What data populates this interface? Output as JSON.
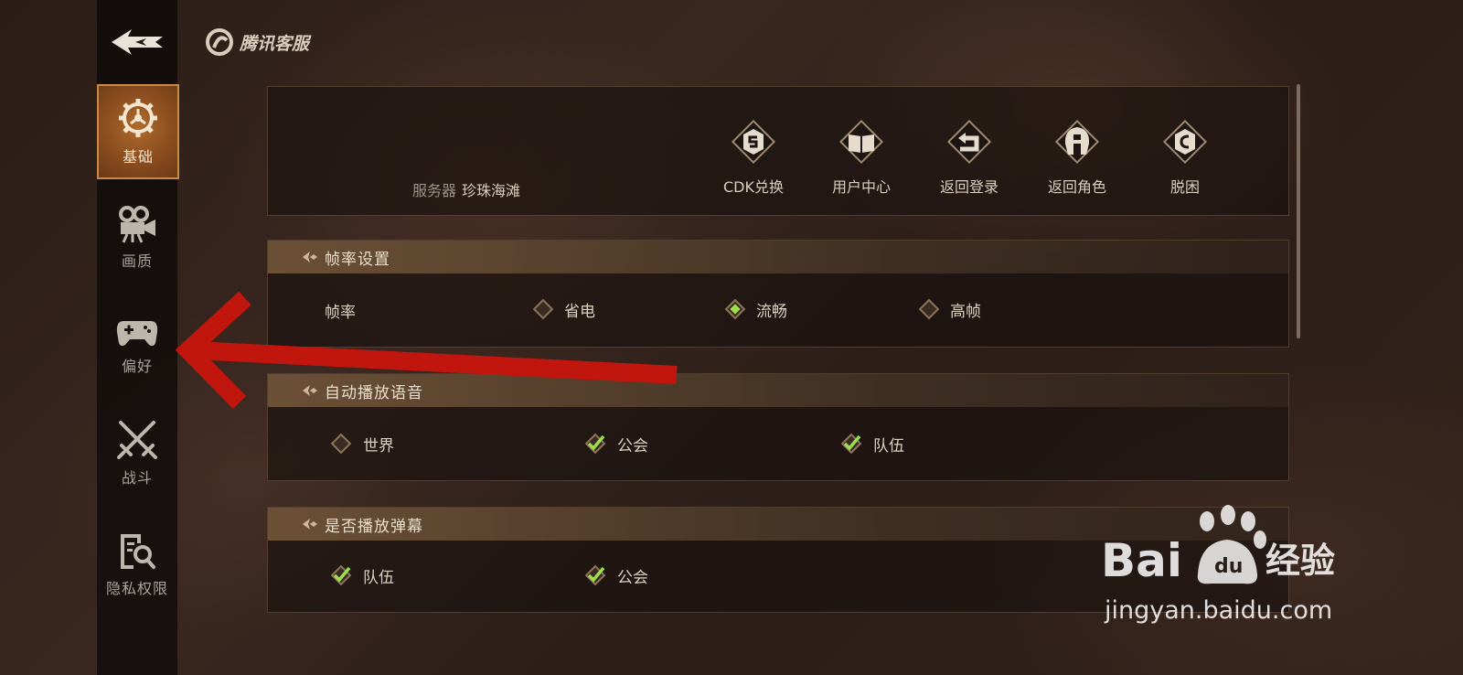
{
  "brand": {
    "name": "腾讯客服"
  },
  "sidebar": {
    "items": [
      {
        "label": "基础",
        "icon": "settings-gear-icon",
        "active": true
      },
      {
        "label": "画质",
        "icon": "camera-icon"
      },
      {
        "label": "偏好",
        "icon": "gamepad-icon"
      },
      {
        "label": "战斗",
        "icon": "crossed-swords-icon"
      },
      {
        "label": "隐私权限",
        "icon": "document-search-icon"
      }
    ]
  },
  "server_panel": {
    "server_key": "服务器",
    "server_value": "珍珠海滩",
    "actions": [
      {
        "label": "CDK兑换",
        "icon": "cdk-icon"
      },
      {
        "label": "用户中心",
        "icon": "book-icon"
      },
      {
        "label": "返回登录",
        "icon": "return-icon"
      },
      {
        "label": "返回角色",
        "icon": "helmet-icon"
      },
      {
        "label": "脱困",
        "icon": "unstuck-icon"
      }
    ]
  },
  "framerate": {
    "title": "帧率设置",
    "row_label": "帧率",
    "options": [
      {
        "label": "省电",
        "selected": false
      },
      {
        "label": "流畅",
        "selected": true
      },
      {
        "label": "高帧",
        "selected": false
      }
    ]
  },
  "auto_voice": {
    "title": "自动播放语音",
    "options": [
      {
        "label": "世界",
        "checked": false
      },
      {
        "label": "公会",
        "checked": true
      },
      {
        "label": "队伍",
        "checked": true
      }
    ]
  },
  "danmaku": {
    "title": "是否播放弹幕",
    "options": [
      {
        "label": "队伍",
        "checked": true
      },
      {
        "label": "公会",
        "checked": true
      }
    ]
  },
  "watermark": {
    "brand_text": "Bai",
    "brand_text2": "经验",
    "url": "jingyan.baidu.com"
  },
  "colors": {
    "accent_orange": "#b06a2c",
    "check_green": "#9be04a",
    "arrow_red": "#c0160e"
  }
}
